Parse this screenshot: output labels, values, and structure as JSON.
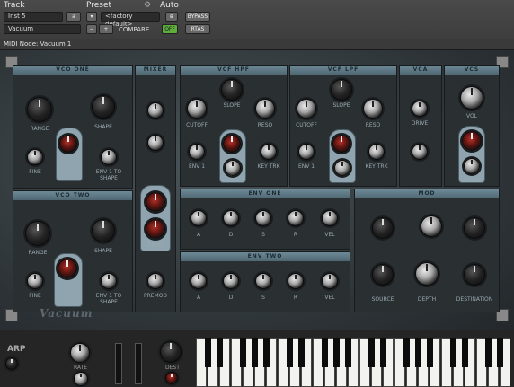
{
  "header": {
    "track_label": "Track",
    "preset_label": "Preset",
    "auto_label": "Auto",
    "track_name": "Inst 5",
    "track_slot": "a",
    "plugin_name": "Vacuum",
    "preset_name": "<factory default>",
    "compare_label": "COMPARE",
    "bypass_label": "BYPASS",
    "safe_label": "OFF",
    "rtas_label": "RTAS",
    "midi_node": "MIDI Node: Vacuum 1"
  },
  "synth": {
    "brand": "Vacuum",
    "panels": {
      "vco1": "VCO ONE",
      "vco2": "VCO TWO",
      "mixer": "MIXER",
      "vcf_hpf": "VCF HPF",
      "vcf_lpf": "VCF LPF",
      "vca": "VCA",
      "env_one": "ENV ONE",
      "env_two": "ENV TWO",
      "mod": "MOD",
      "vcs": "VCS"
    },
    "labels": {
      "range": "RANGE",
      "shape": "SHAPE",
      "fine": "FINE",
      "env_to_shape": "ENV 1 TO SHAPE",
      "cutoff": "CUTOFF",
      "reso": "RESO",
      "slope": "SLOPE",
      "env1": "ENV 1",
      "key_trk": "KEY TRK",
      "drive": "DRIVE",
      "vol": "VOL",
      "premod": "PREMOD",
      "a": "A",
      "d": "D",
      "s": "S",
      "r": "R",
      "vel": "VEL",
      "source": "SOURCE",
      "depth": "DEPTH",
      "destination": "DESTINATION"
    }
  },
  "keyboard": {
    "arp_label": "ARP",
    "rate_label": "RATE",
    "oct_label": "OCT",
    "dest_label": "DEST"
  }
}
